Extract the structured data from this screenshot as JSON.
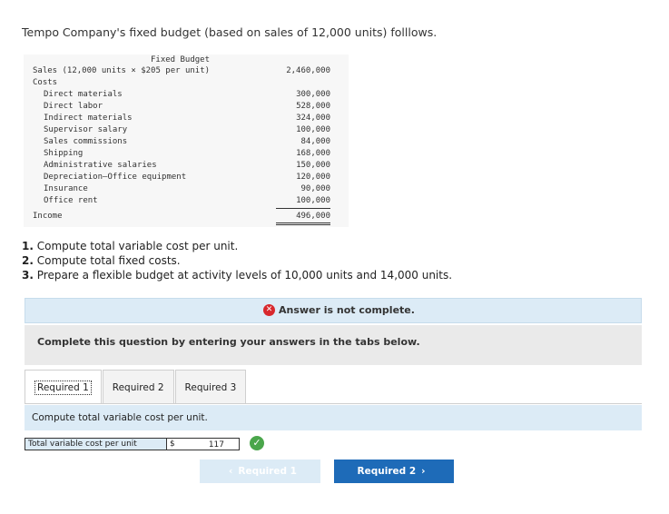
{
  "intro": "Tempo Company's fixed budget (based on sales of 12,000 units) folllows.",
  "budget": {
    "column_header": "Fixed Budget",
    "sales": {
      "label": "Sales (12,000 units × $205 per unit)",
      "amount": "2,460,000"
    },
    "costs_label": "Costs",
    "items": [
      {
        "label": "Direct materials",
        "amount": "300,000"
      },
      {
        "label": "Direct labor",
        "amount": "528,000"
      },
      {
        "label": "Indirect materials",
        "amount": "324,000"
      },
      {
        "label": "Supervisor salary",
        "amount": "100,000"
      },
      {
        "label": "Sales commissions",
        "amount": "84,000"
      },
      {
        "label": "Shipping",
        "amount": "168,000"
      },
      {
        "label": "Administrative salaries",
        "amount": "150,000"
      },
      {
        "label": "Depreciation—Office equipment",
        "amount": "120,000"
      },
      {
        "label": "Insurance",
        "amount": "90,000"
      },
      {
        "label": "Office rent",
        "amount": "100,000"
      }
    ],
    "income": {
      "label": "Income",
      "amount": "496,000"
    }
  },
  "questions": [
    {
      "num": "1.",
      "text": "Compute total variable cost per unit."
    },
    {
      "num": "2.",
      "text": "Compute total fixed costs."
    },
    {
      "num": "3.",
      "text": "Prepare a flexible budget at activity levels of 10,000 units and 14,000 units."
    }
  ],
  "notice": "Answer is not complete.",
  "band_text": "Complete this question by entering your answers in the tabs below.",
  "tabs": [
    "Required 1",
    "Required 2",
    "Required 3"
  ],
  "instruction": "Compute total variable cost per unit.",
  "answer": {
    "label": "Total variable cost per unit",
    "currency": "$",
    "value": "117"
  },
  "nav": {
    "prev": "Required 1",
    "next": "Required 2"
  },
  "colors": {
    "accent": "#1e6bb8",
    "panel": "#dcebf6",
    "error": "#d8282d",
    "success": "#4aa64b"
  }
}
